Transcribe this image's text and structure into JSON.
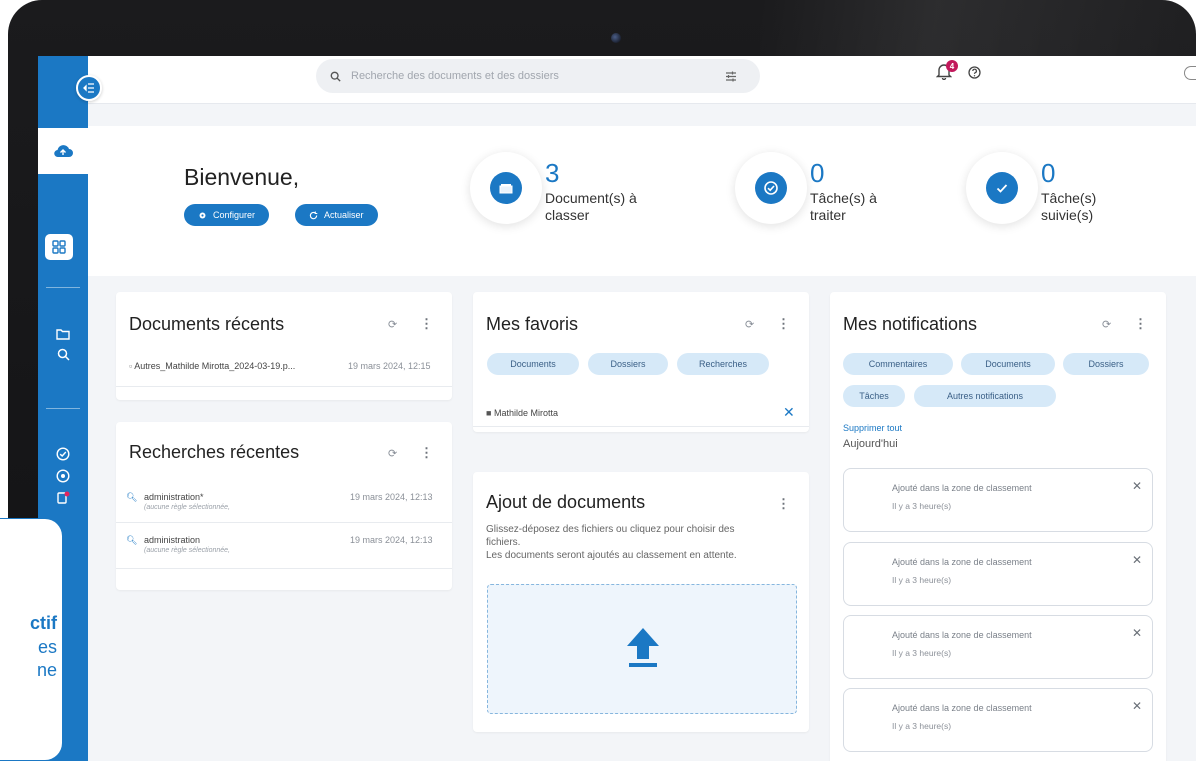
{
  "topbar": {
    "search_placeholder": "Recherche des documents et des dossiers",
    "notification_count": "4",
    "icons": [
      "menu-collapse-icon",
      "search-icon",
      "filter-icon",
      "bell-icon",
      "help-icon"
    ]
  },
  "header": {
    "welcome": "Bienvenue,",
    "configure_label": "Configurer",
    "refresh_label": "Actualiser",
    "stats": [
      {
        "value": "3",
        "label_line1": "Document(s) à",
        "label_line2": "classer"
      },
      {
        "value": "0",
        "label_line1": "Tâche(s) à",
        "label_line2": "traiter"
      },
      {
        "value": "0",
        "label_line1": "Tâche(s)",
        "label_line2": "suivie(s)"
      }
    ]
  },
  "recent_docs": {
    "title": "Documents récents",
    "items": [
      {
        "name": "Autres_Mathilde Mirotta_2024-03-19.p...",
        "date": "19 mars 2024, 12:15"
      }
    ]
  },
  "recent_searches": {
    "title": "Recherches récentes",
    "items": [
      {
        "query": "administration*",
        "sub": "(aucune règle sélectionnée,",
        "date": "19 mars 2024, 12:13"
      },
      {
        "query": "administration",
        "sub": "(aucune règle sélectionnée,",
        "date": "19 mars 2024, 12:13"
      }
    ]
  },
  "favorites": {
    "title": "Mes favoris",
    "chips": [
      "Documents",
      "Dossiers",
      "Recherches"
    ],
    "items": [
      {
        "name": "Mathilde Mirotta"
      }
    ]
  },
  "upload": {
    "title": "Ajout de documents",
    "desc_line1": "Glissez-déposez des fichiers ou cliquez pour choisir des",
    "desc_line2": "fichiers.",
    "desc_line3": "Les documents seront ajoutés au classement en attente."
  },
  "notifications": {
    "title": "Mes notifications",
    "chips": [
      "Commentaires",
      "Documents",
      "Dossiers",
      "Tâches",
      "Autres notifications"
    ],
    "clear_all": "Supprimer tout",
    "today": "Aujourd'hui",
    "items": [
      {
        "title": "Ajouté dans la zone de classement",
        "time": "Il y a 3 heure(s)"
      },
      {
        "title": "Ajouté dans la zone de classement",
        "time": "Il y a 3 heure(s)"
      },
      {
        "title": "Ajouté dans la zone de classement",
        "time": "Il y a 3 heure(s)"
      },
      {
        "title": "Ajouté dans la zone de classement",
        "time": "Il y a 3 heure(s)"
      }
    ]
  },
  "callout": {
    "line1": "ctif",
    "line2": "es",
    "line3": "ne"
  },
  "colors": {
    "accent": "#1b78c4",
    "chip": "#d6e9f8",
    "badge": "#c2185b"
  }
}
